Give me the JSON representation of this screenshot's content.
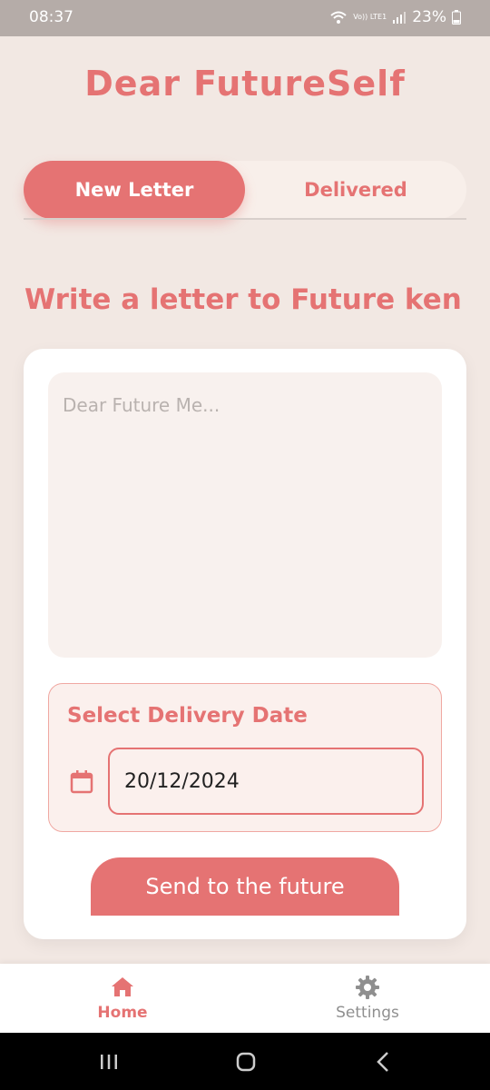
{
  "status_bar": {
    "time": "08:37",
    "network_label": "Vo)) LTE1",
    "battery": "23%"
  },
  "app": {
    "title": "Dear FutureSelf"
  },
  "tabs": [
    {
      "label": "New Letter",
      "active": true
    },
    {
      "label": "Delivered",
      "active": false
    }
  ],
  "compose": {
    "heading": "Write a letter to Future ken",
    "letter_placeholder": "Dear Future Me...",
    "letter_value": "",
    "date_label": "Select Delivery Date",
    "date_value": "20/12/2024",
    "send_label": "Send to the future"
  },
  "bottom_nav": [
    {
      "label": "Home",
      "icon": "home-icon",
      "active": true
    },
    {
      "label": "Settings",
      "icon": "gear-icon",
      "active": false
    }
  ],
  "colors": {
    "accent": "#e57373",
    "background": "#f2e8e3",
    "card": "#ffffff",
    "input_bg": "#f8f1ee"
  }
}
